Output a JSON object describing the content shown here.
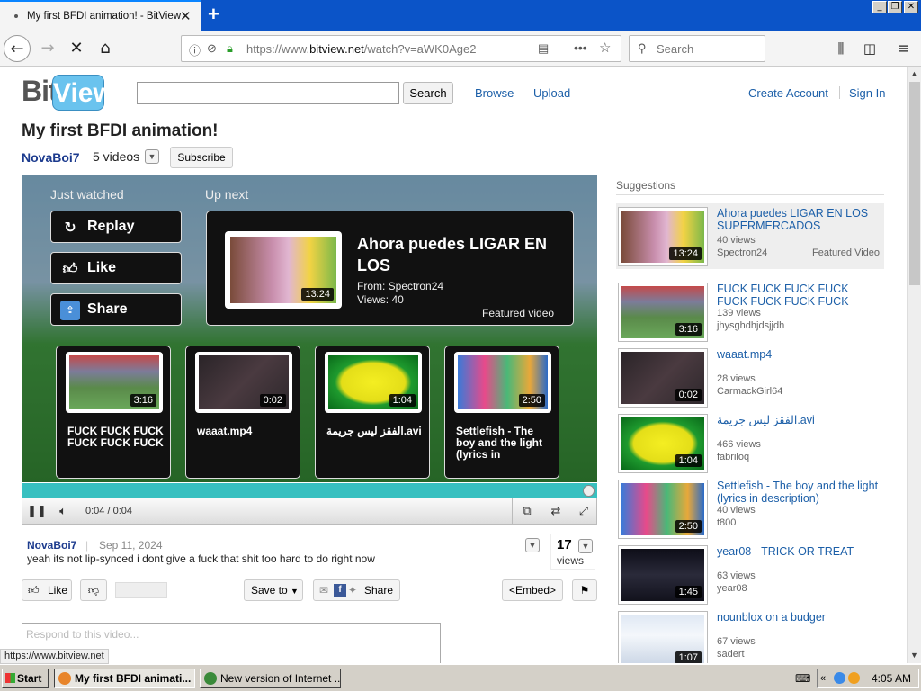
{
  "browser": {
    "tab_title": "My first BFDI animation! - BitView",
    "url_prefix": "https://www.",
    "url_domain": "bitview.net",
    "url_path": "/watch?v=aWK0Age2",
    "search_placeholder": "Search",
    "status_url": "https://www.bitview.net"
  },
  "site": {
    "logo_left": "Bit",
    "logo_right": "View",
    "search_button": "Search",
    "nav": [
      "Browse",
      "Upload"
    ],
    "account": [
      "Create Account",
      "Sign In"
    ]
  },
  "video": {
    "title": "My first BFDI animation!",
    "uploader": "NovaBoi7",
    "video_count": "5 videos",
    "subscribe": "Subscribe",
    "time": "0:04 / 0:04",
    "progress": 1.0
  },
  "player": {
    "just_watched": "Just watched",
    "up_next": "Up next",
    "buttons": [
      {
        "label": "Replay",
        "icon": "replay-icon"
      },
      {
        "label": "Like",
        "icon": "thumbs-up-icon"
      },
      {
        "label": "Share",
        "icon": "share-icon"
      }
    ],
    "next": {
      "title": "Ahora puedes LIGAR EN LOS",
      "from": "From: Spectron24",
      "views": "Views: 40",
      "featured": "Featured video",
      "duration": "13:24"
    },
    "grid": [
      {
        "title": "FUCK FUCK FUCK FUCK FUCK FUCK",
        "duration": "3:16"
      },
      {
        "title": "waaat.mp4",
        "duration": "0:02"
      },
      {
        "title": "الفقز ليس جريمة.avi",
        "duration": "1:04"
      },
      {
        "title": "Settlefish - The boy and the light (lyrics in",
        "duration": "2:50"
      }
    ]
  },
  "comment": {
    "user": "NovaBoi7",
    "date": "Sep 11, 2024",
    "text": "yeah its not lip-synced i dont give a fuck that shit too hard to do right now"
  },
  "views": {
    "count": "17",
    "label": "views"
  },
  "actions": {
    "like": "Like",
    "save_to": "Save to",
    "share": "Share",
    "embed": "<Embed>",
    "respond_placeholder": "Respond to this video..."
  },
  "suggestions": {
    "heading": "Suggestions",
    "items": [
      {
        "title": "Ahora puedes LIGAR EN LOS SUPERMERCADOS",
        "views": "40 views",
        "user": "Spectron24",
        "duration": "13:24",
        "featured": "Featured Video"
      },
      {
        "title": "FUCK FUCK FUCK FUCK FUCK FUCK FUCK FUCK",
        "views": "139 views",
        "user": "jhysghdhjdsjjdh",
        "duration": "3:16"
      },
      {
        "title": "waaat.mp4",
        "views": "28 views",
        "user": "CarmackGirl64",
        "duration": "0:02"
      },
      {
        "title": "الفقز ليس جريمة.avi",
        "views": "466 views",
        "user": "fabriloq",
        "duration": "1:04"
      },
      {
        "title": "Settlefish - The boy and the light (lyrics in description)",
        "views": "40 views",
        "user": "t800",
        "duration": "2:50"
      },
      {
        "title": "year08 - TRICK OR TREAT",
        "views": "63 views",
        "user": "year08",
        "duration": "1:45"
      },
      {
        "title": "nounblox on a budger",
        "views": "67 views",
        "user": "sadert",
        "duration": "1:07"
      }
    ]
  },
  "taskbar": {
    "start": "Start",
    "tasks": [
      "My first BFDI animati...",
      "New version of Internet ..."
    ],
    "clock": "4:05 AM"
  }
}
